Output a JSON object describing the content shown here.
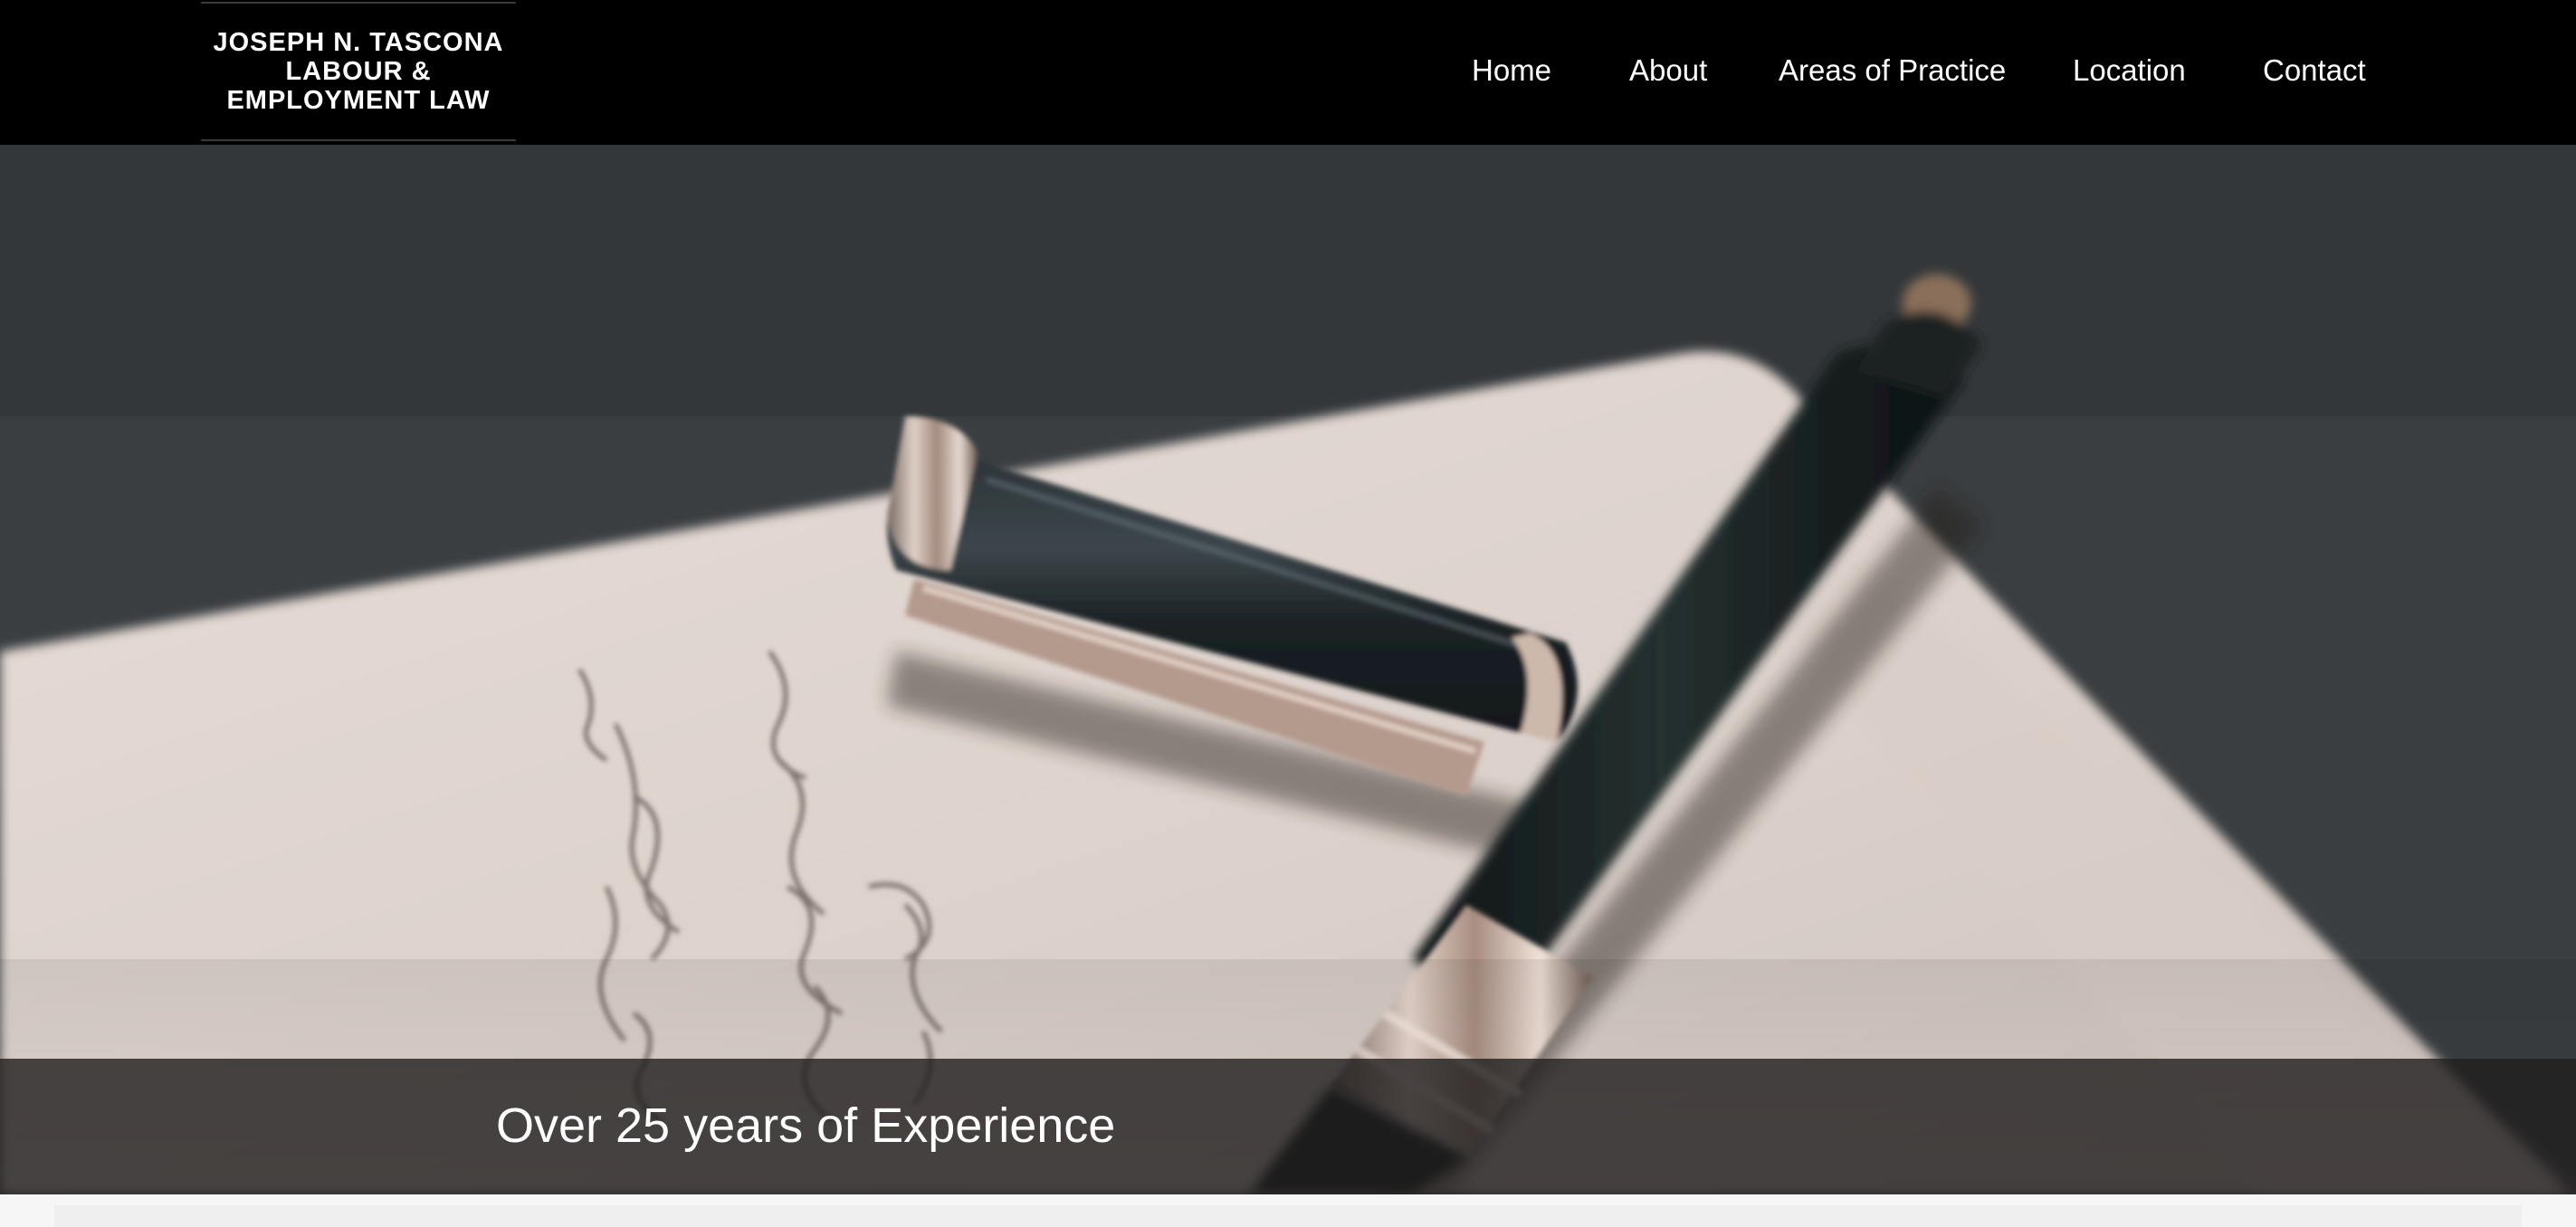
{
  "header": {
    "logo": {
      "line1": "JOSEPH N. TASCONA",
      "line2": "LABOUR &",
      "line3": "EMPLOYMENT LAW"
    },
    "nav": [
      {
        "label": "Home"
      },
      {
        "label": "About"
      },
      {
        "label": "Areas of Practice"
      },
      {
        "label": "Location"
      },
      {
        "label": "Contact"
      }
    ]
  },
  "hero": {
    "caption": "Over 25 years of Experience"
  },
  "colors": {
    "header_bg": "#000000",
    "nav_text": "#ffffff",
    "caption_bar": "#201e1e",
    "page_bg": "#f4f4f4"
  }
}
